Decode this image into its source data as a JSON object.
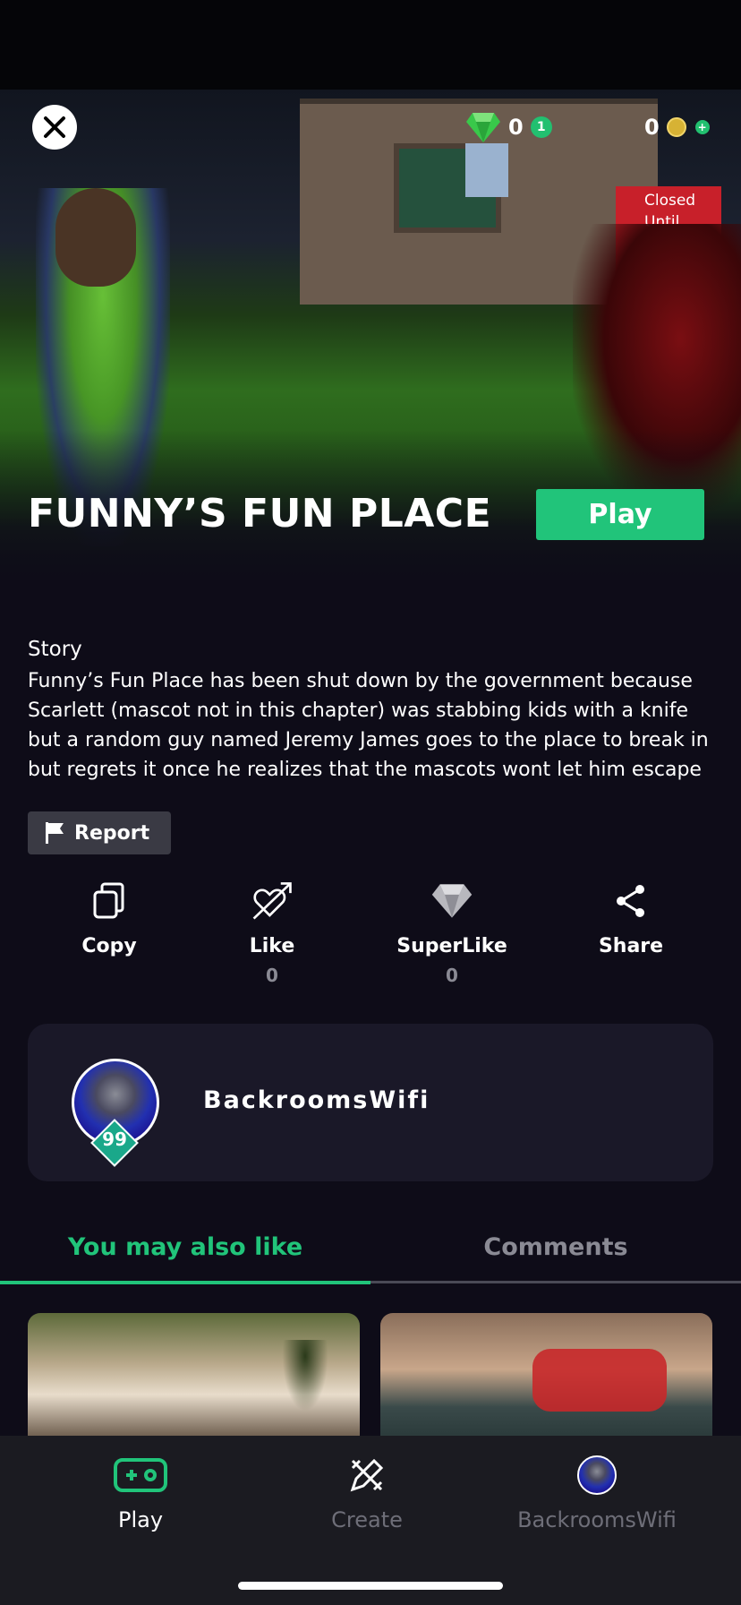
{
  "header": {
    "gems_value": "0",
    "gems_badge": "1",
    "coins_value": "0",
    "coins_badge": "+"
  },
  "hero": {
    "sign_text": "Closed Until Furthe Noti",
    "title": "FUNNY’S FUN PLACE",
    "play_label": "Play"
  },
  "story": {
    "heading": "Story",
    "text": "Funny’s Fun Place has been shut down by the government because Scarlett (mascot not in this chapter) was stabbing kids with a knife but a random guy named Jeremy James goes to the place to break in but regrets it once he realizes that the mascots wont let him escape"
  },
  "report": {
    "label": "Report"
  },
  "actions": [
    {
      "label": "Copy",
      "count": ""
    },
    {
      "label": "Like",
      "count": "0"
    },
    {
      "label": "SuperLike",
      "count": "0"
    },
    {
      "label": "Share",
      "count": ""
    }
  ],
  "creator": {
    "name": "BackroomsWifi",
    "level": "99"
  },
  "tabs": [
    {
      "label": "You may also like",
      "active": true
    },
    {
      "label": "Comments",
      "active": false
    }
  ],
  "bottom_nav": [
    {
      "label": "Play",
      "active": true
    },
    {
      "label": "Create",
      "active": false
    },
    {
      "label": "BackroomsWifi",
      "active": false
    }
  ],
  "colors": {
    "accent": "#21c47a",
    "background": "#0e0c18",
    "card": "#1a1828",
    "nav": "#1b1b21"
  },
  "icons": [
    "close-icon",
    "gem-icon",
    "coin-icon",
    "flag-icon",
    "copy-icon",
    "heart-arrow-icon",
    "diamond-icon",
    "share-icon",
    "gamepad-icon",
    "pencil-ruler-icon"
  ]
}
